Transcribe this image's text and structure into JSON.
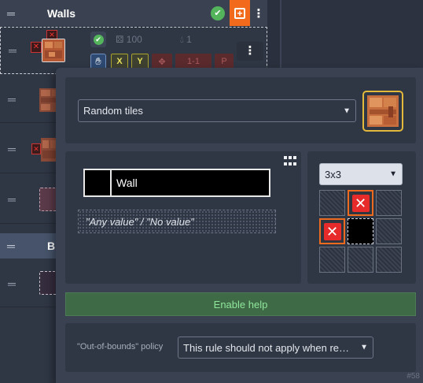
{
  "group": {
    "title": "Walls",
    "title_b": "B"
  },
  "selected_rule": {
    "chance": "100",
    "perlin": "1",
    "x_label": "X",
    "y_label": "Y",
    "size_box": "1-1",
    "p_label": "P"
  },
  "panel": {
    "mode_select": "Random tiles",
    "int_grid_value": "Wall",
    "any_value_text": "\"Any value\" / \"No value\"",
    "pattern_size": "3x3",
    "help_button": "Enable help",
    "oob_label": "\"Out-of-bounds\" policy",
    "oob_select": "This rule should not apply when re…",
    "rule_uid": "#58"
  },
  "colors": {
    "accent_orange": "#f26b1d",
    "check_green": "#53b45b",
    "negative_red": "#e72b2b",
    "help_green": "#3e6a46"
  },
  "icons": {
    "grip": "drag-handle-icon",
    "check": "check-circle-icon",
    "add": "add-square-icon",
    "more": "more-vertical-icon",
    "grid": "grid-icon",
    "dice": "dice-icon",
    "drop": "drop-icon",
    "hand": "hand-icon",
    "move": "move-icon"
  }
}
